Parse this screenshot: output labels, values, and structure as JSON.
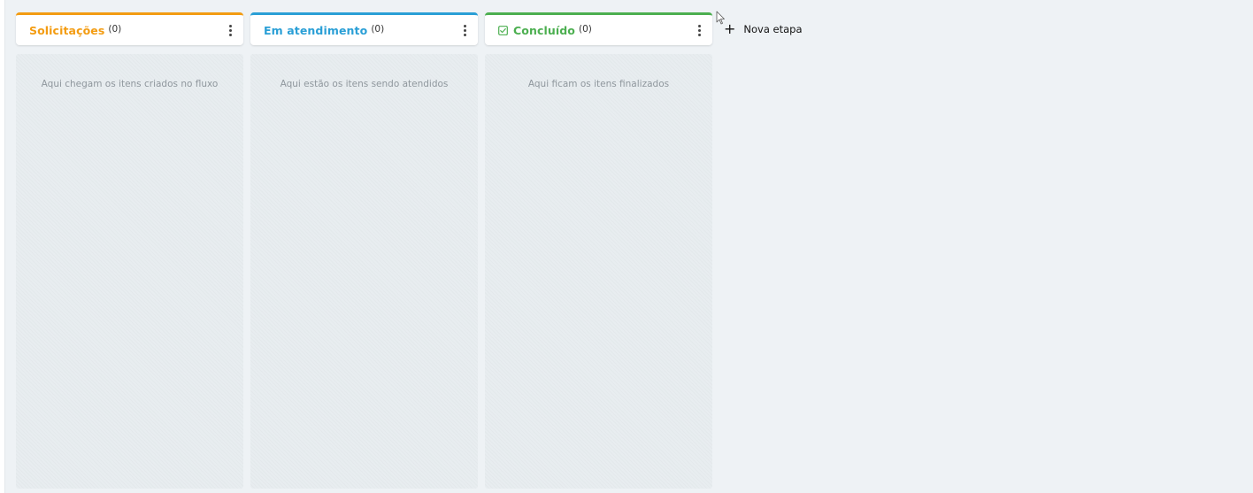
{
  "colors": {
    "background": "#eef2f5",
    "solicitacoes": "#f39c12",
    "em_atendimento": "#2a9fd6",
    "concluido": "#4caf50"
  },
  "columns": [
    {
      "title": "Solicitações",
      "count": "(0)",
      "empty_text": "Aqui chegam os itens criados no fluxo"
    },
    {
      "title": "Em atendimento",
      "count": "(0)",
      "empty_text": "Aqui estão os itens sendo atendidos"
    },
    {
      "title": "Concluído",
      "count": "(0)",
      "empty_text": "Aqui ficam os itens finalizados",
      "icon": "check-square-icon"
    }
  ],
  "add_stage": {
    "label": "Nova etapa",
    "icon": "plus-icon"
  },
  "icons": {
    "column_menu": "more-vertical-icon",
    "cursor": "mouse-pointer-icon"
  }
}
